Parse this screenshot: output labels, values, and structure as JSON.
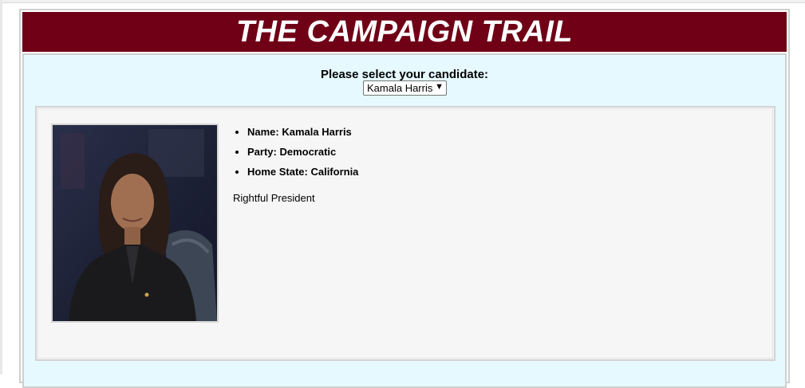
{
  "header": {
    "title": "THE CAMPAIGN TRAIL"
  },
  "selector": {
    "label": "Please select your candidate:",
    "selected": "Kamala Harris"
  },
  "candidate": {
    "name_line": "Name: Kamala Harris",
    "party_line": "Party: Democratic",
    "state_line": "Home State: California",
    "description": "Rightful President",
    "photo_icon": "candidate-portrait"
  },
  "colors": {
    "banner": "#6f0016",
    "panel": "#e6f9ff",
    "card": "#f6f6f6"
  }
}
